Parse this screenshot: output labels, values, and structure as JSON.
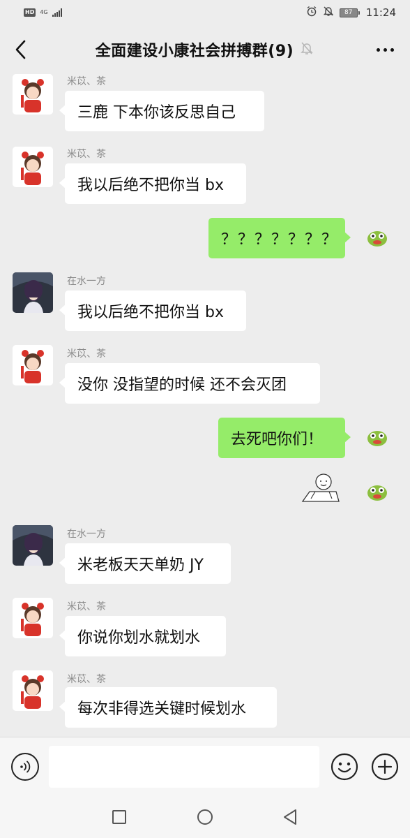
{
  "status_bar": {
    "hd": "HD",
    "network": "4G",
    "battery": "87",
    "time": "11:24"
  },
  "header": {
    "title": "全面建设小康社会拼搏群(9)"
  },
  "messages": [
    {
      "side": "left",
      "avatar": "cartoon-girl-avatar",
      "sender": "米苡、茶",
      "text": "三鹿 下本你该反思自己"
    },
    {
      "side": "left",
      "avatar": "cartoon-girl-avatar",
      "sender": "米苡、茶",
      "text": "我以后绝不把你当 bx"
    },
    {
      "side": "right",
      "avatar": "frog-avatar",
      "text": "？？？？？？？"
    },
    {
      "side": "left",
      "avatar": "anime-character-avatar",
      "sender": "在水一方",
      "text": "我以后绝不把你当 bx"
    },
    {
      "side": "left",
      "avatar": "cartoon-girl-avatar",
      "sender": "米苡、茶",
      "text": "没你 没指望的时候 还不会灭团"
    },
    {
      "side": "right",
      "avatar": "frog-avatar",
      "text": "去死吧你们！"
    },
    {
      "side": "right",
      "avatar": "frog-avatar",
      "sticker": "sketch-face-sticker"
    },
    {
      "side": "left",
      "avatar": "anime-character-avatar",
      "sender": "在水一方",
      "text": "米老板天天单奶 JY"
    },
    {
      "side": "left",
      "avatar": "cartoon-girl-avatar",
      "sender": "米苡、茶",
      "text": "你说你划水就划水"
    },
    {
      "side": "left",
      "avatar": "cartoon-girl-avatar",
      "sender": "米苡、茶",
      "text": "每次非得选关键时候划水"
    }
  ],
  "input": {
    "value": "",
    "placeholder": ""
  },
  "icons": {
    "voice": "voice-icon",
    "emoji": "emoji-icon",
    "plus": "plus-icon",
    "mute": "mute-bell-icon"
  },
  "colors": {
    "background": "#ededed",
    "sent_bubble": "#95ec69",
    "received_bubble": "#ffffff"
  }
}
